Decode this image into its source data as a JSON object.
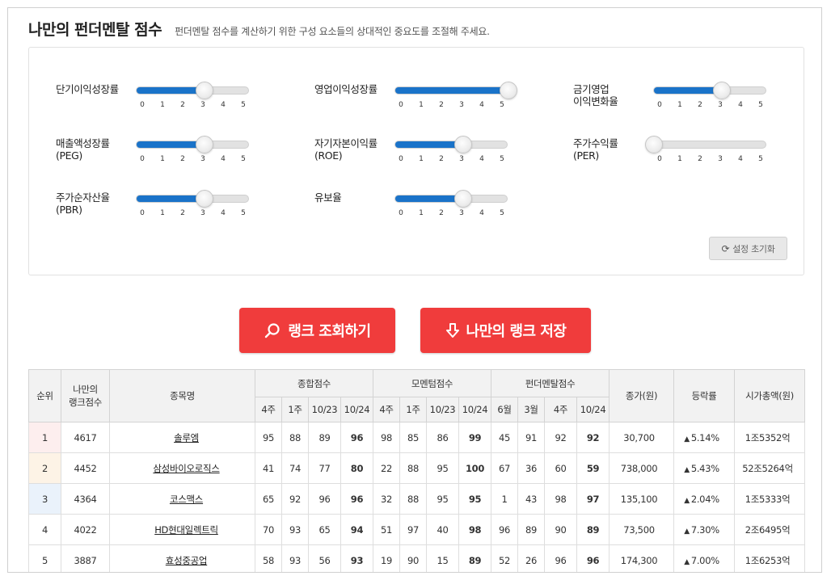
{
  "header": {
    "title": "나만의 펀더멘탈 점수",
    "description": "펀더멘탈 점수를 계산하기 위한 구성 요소들의 상대적인 중요도를 조절해 주세요."
  },
  "sliders": [
    {
      "label": "단기이익성장률",
      "value": 3
    },
    {
      "label": "영업이익성장률",
      "value": 5
    },
    {
      "label": "금기영업\n이익변화율",
      "value": 3
    },
    {
      "label": "매출액성장률\n(PEG)",
      "value": 3
    },
    {
      "label": "자기자본이익률\n(ROE)",
      "value": 3
    },
    {
      "label": "주가수익률\n(PER)",
      "value": 0
    },
    {
      "label": "주가순자산율\n(PBR)",
      "value": 3
    },
    {
      "label": "유보율",
      "value": 3
    }
  ],
  "slider_ticks": [
    "0",
    "1",
    "2",
    "3",
    "4",
    "5"
  ],
  "slider_max": 5,
  "reset_label": "설정 초기화",
  "buttons": {
    "search": "랭크 조회하기",
    "save": "나만의 랭크 저장"
  },
  "table": {
    "headers": {
      "rank": "순위",
      "my_score": "나만의\n랭크점수",
      "name": "종목명",
      "total": "종합점수",
      "momentum": "모멘텀점수",
      "fundamental": "펀더멘탈점수",
      "price": "종가(원)",
      "change": "등락률",
      "cap": "시가총액(원)"
    },
    "sub_total": [
      "4주",
      "1주",
      "10/23",
      "10/24"
    ],
    "sub_momentum": [
      "4주",
      "1주",
      "10/23",
      "10/24"
    ],
    "sub_fund": [
      "6월",
      "3월",
      "4주",
      "10/24"
    ],
    "rows": [
      {
        "rank": "1",
        "score": "4617",
        "name": "솔루엠",
        "t": [
          "95",
          "88",
          "89",
          "96"
        ],
        "m": [
          "98",
          "85",
          "86",
          "99"
        ],
        "f": [
          "45",
          "91",
          "92",
          "92"
        ],
        "price": "30,700",
        "change": "5.14%",
        "cap": "1조5352억"
      },
      {
        "rank": "2",
        "score": "4452",
        "name": "삼성바이오로직스",
        "t": [
          "41",
          "74",
          "77",
          "80"
        ],
        "m": [
          "22",
          "88",
          "95",
          "100"
        ],
        "f": [
          "67",
          "36",
          "60",
          "59"
        ],
        "price": "738,000",
        "change": "5.43%",
        "cap": "52조5264억"
      },
      {
        "rank": "3",
        "score": "4364",
        "name": "코스맥스",
        "t": [
          "65",
          "92",
          "96",
          "96"
        ],
        "m": [
          "32",
          "88",
          "95",
          "95"
        ],
        "f": [
          "1",
          "43",
          "98",
          "97"
        ],
        "price": "135,100",
        "change": "2.04%",
        "cap": "1조5333억"
      },
      {
        "rank": "4",
        "score": "4022",
        "name": "HD현대일렉트릭",
        "t": [
          "70",
          "93",
          "65",
          "94"
        ],
        "m": [
          "51",
          "97",
          "40",
          "98"
        ],
        "f": [
          "96",
          "89",
          "90",
          "89"
        ],
        "price": "73,500",
        "change": "7.30%",
        "cap": "2조6495억"
      },
      {
        "rank": "5",
        "score": "3887",
        "name": "효성중공업",
        "t": [
          "58",
          "93",
          "56",
          "93"
        ],
        "m": [
          "19",
          "90",
          "15",
          "89"
        ],
        "f": [
          "52",
          "26",
          "96",
          "96"
        ],
        "price": "174,300",
        "change": "7.00%",
        "cap": "1조6253억"
      }
    ]
  },
  "colors": {
    "accent_blue": "#1a73c9",
    "button_red": "#f03c3c",
    "change_red": "#e53935",
    "rank1_bg": "#fdeeee",
    "rank2_bg": "#fdf3e6",
    "rank3_bg": "#eaf2fb"
  }
}
